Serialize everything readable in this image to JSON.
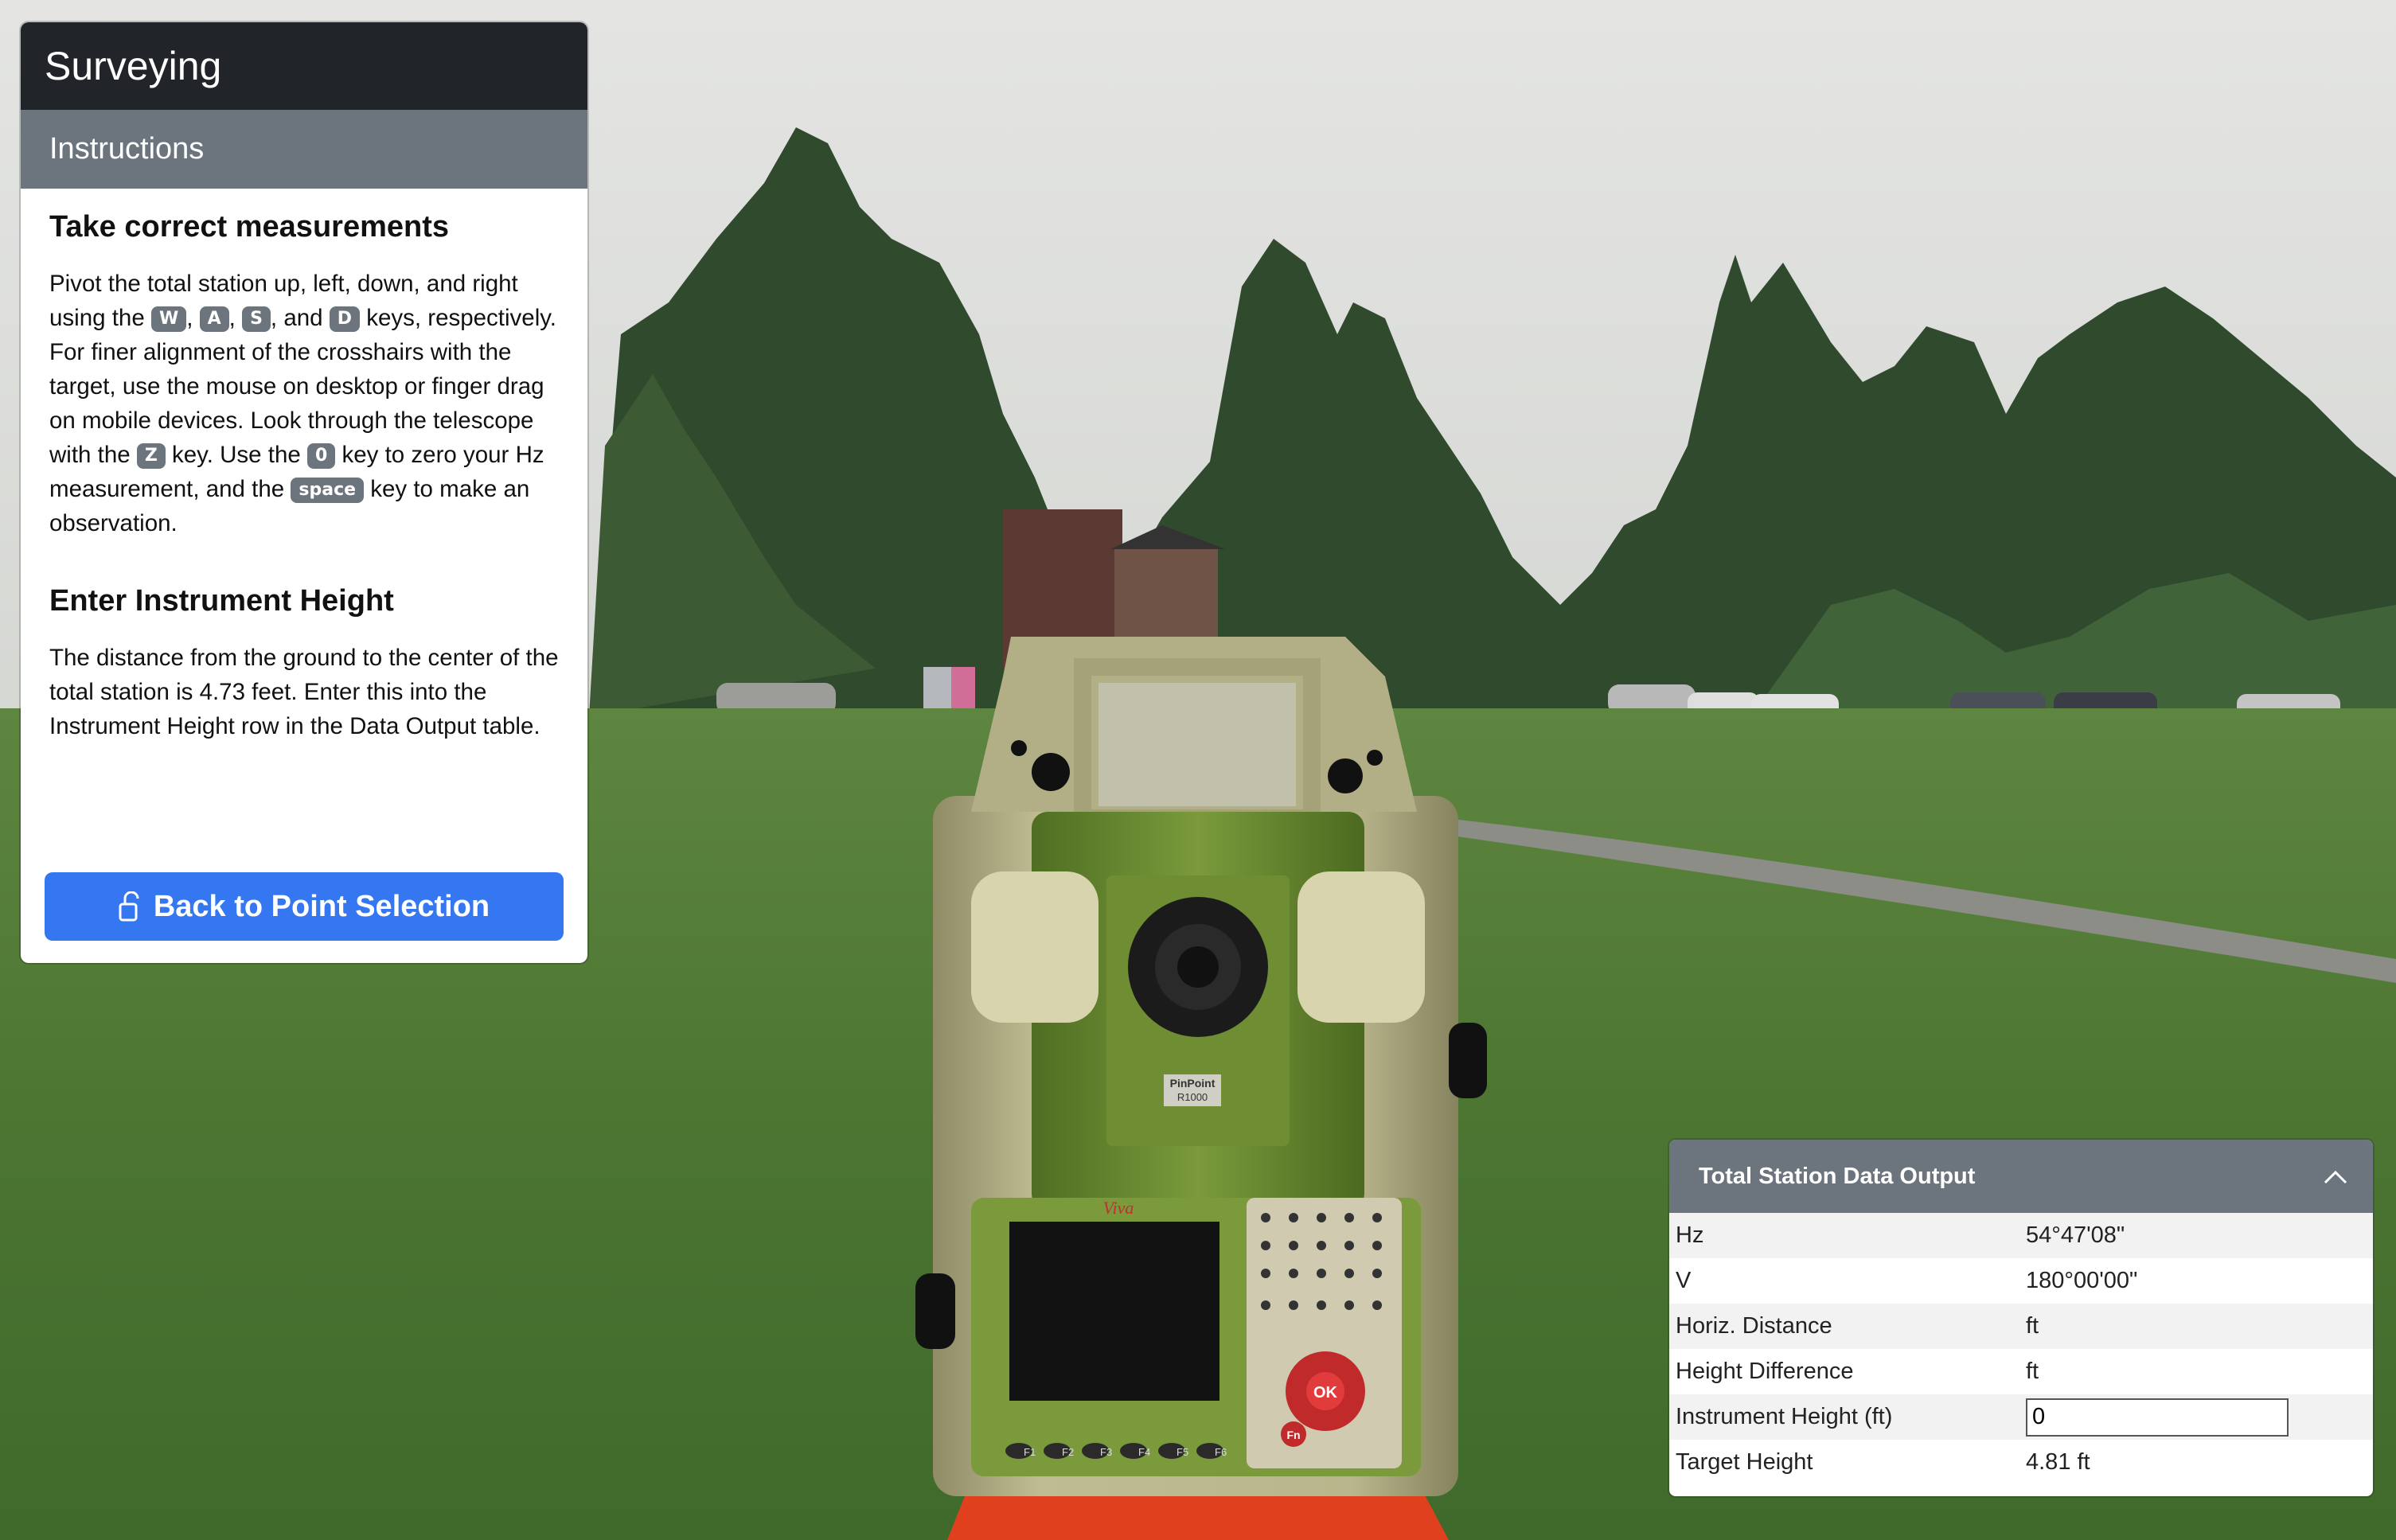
{
  "app": {
    "title": "Surveying",
    "section": "Instructions"
  },
  "instructions": {
    "measure_heading": "Take correct measurements",
    "measure_text": {
      "t1": "Pivot the total station up, left, down, and right using the ",
      "k_w": "W",
      "sep1": ", ",
      "k_a": "A",
      "sep2": ", ",
      "k_s": "S",
      "sep3": ", and ",
      "k_d": "D",
      "t2": " keys, respectively. For finer alignment of the crosshairs with the target, use the mouse on desktop or finger drag on mobile devices. Look through the telescope with the ",
      "k_z": "Z",
      "t3": " key. Use the ",
      "k_0": "0",
      "t4": " key to zero your Hz measurement, and the ",
      "k_space": "space",
      "t5": " key to make an observation."
    },
    "height_heading": "Enter Instrument Height",
    "height_text": "The distance from the ground to the center of the total station is 4.73 feet. Enter this into the Instrument Height row in the Data Output table."
  },
  "back_button": {
    "label": "Back to Point Selection",
    "icon": "unlock-icon"
  },
  "data_output": {
    "title": "Total Station Data Output",
    "collapse_icon": "chevron-up-icon",
    "rows": [
      {
        "label": "Hz",
        "value": "54°47'08\""
      },
      {
        "label": "V",
        "value": "180°00'00\""
      },
      {
        "label": "Horiz. Distance",
        "value": "ft"
      },
      {
        "label": "Height Difference",
        "value": "ft"
      },
      {
        "label": "Instrument Height (ft)",
        "input_value": "0"
      },
      {
        "label": "Target Height",
        "value": "4.81 ft"
      }
    ]
  },
  "instrument": {
    "brand": "Viva",
    "badge_line1": "PinPoint",
    "badge_line2": "R1000",
    "ok_key": "OK",
    "fn_key": "Fn",
    "fkeys": [
      "F1",
      "F2",
      "F3",
      "F4",
      "F5",
      "F6"
    ]
  },
  "colors": {
    "header_dark": "#212529",
    "header_gray": "#6c757d",
    "button_blue": "#3577f1",
    "grass": "#4f7a34"
  }
}
